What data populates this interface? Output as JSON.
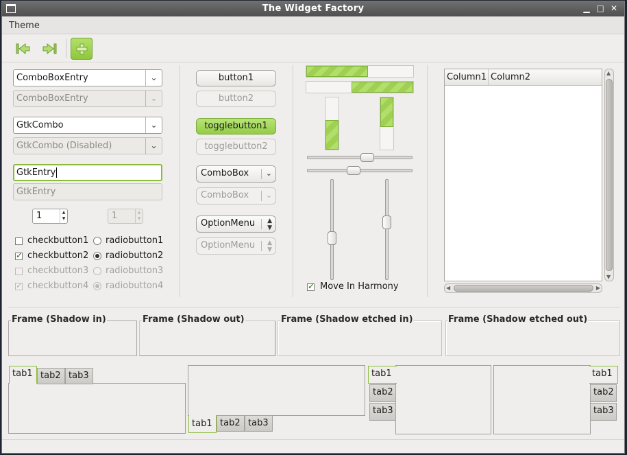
{
  "window": {
    "title": "The Widget Factory",
    "minimize": "▁",
    "maximize": "□",
    "close": "✕"
  },
  "menubar": {
    "items": [
      "Theme"
    ]
  },
  "toolbar": {
    "icons": [
      "go-first-icon",
      "go-last-icon",
      "add-icon"
    ]
  },
  "col1": {
    "comboentry1": "ComboBoxEntry",
    "comboentry2": "ComboBoxEntry",
    "gtkcombo1": "GtkCombo",
    "gtkcombo2": "GtkCombo (Disabled)",
    "entry1": "GtkEntry",
    "entry2": "GtkEntry",
    "spin1": "1",
    "spin2": "1",
    "checks": [
      "checkbutton1",
      "checkbutton2",
      "checkbutton3",
      "checkbutton4"
    ],
    "radios": [
      "radiobutton1",
      "radiobutton2",
      "radiobutton3",
      "radiobutton4"
    ]
  },
  "col2": {
    "button1": "button1",
    "button2": "button2",
    "toggle1": "togglebutton1",
    "toggle2": "togglebutton2",
    "combobox1": "ComboBox",
    "combobox2": "ComboBox",
    "option1": "OptionMenu",
    "option2": "OptionMenu"
  },
  "col3": {
    "progress": {
      "h1": 0.58,
      "h2": 0.58,
      "v1": 0.56,
      "v2": 0.56
    },
    "scales": {
      "h1": 0.58,
      "h2": 0.43,
      "v1": 0.6,
      "v2": 0.42
    },
    "harmony": "Move In Harmony"
  },
  "tree": {
    "columns": [
      "Column1",
      "Column2"
    ]
  },
  "frames": [
    "Frame (Shadow in)",
    "Frame (Shadow out)",
    "Frame (Shadow etched in)",
    "Frame (Shadow etched out)"
  ],
  "notebooks": {
    "tabs": [
      "tab1",
      "tab2",
      "tab3"
    ]
  },
  "colors": {
    "accent": "#9fd052",
    "accent_border": "#7fb238"
  }
}
